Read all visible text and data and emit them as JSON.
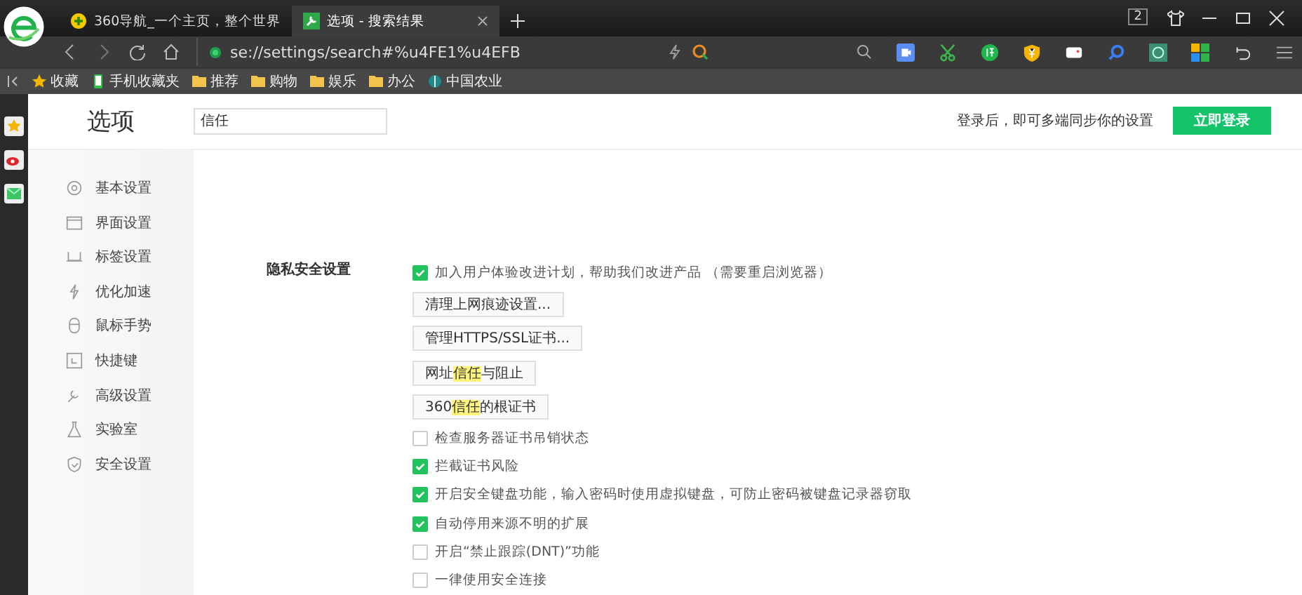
{
  "tabs": [
    {
      "title": "360导航_一个主页，整个世界",
      "selected": false
    },
    {
      "title": "选项 - 搜索结果",
      "selected": true
    }
  ],
  "window_controls": {
    "tab_count": "2"
  },
  "address_bar": {
    "url": "se://settings/search#%u4FE1%u4EFB"
  },
  "bookmarks": [
    {
      "label": "收藏",
      "kind": "star"
    },
    {
      "label": "手机收藏夹",
      "kind": "phone"
    },
    {
      "label": "推荐",
      "kind": "folder"
    },
    {
      "label": "购物",
      "kind": "folder"
    },
    {
      "label": "娱乐",
      "kind": "folder"
    },
    {
      "label": "办公",
      "kind": "folder"
    },
    {
      "label": "中国农业",
      "kind": "globe"
    }
  ],
  "settings": {
    "title": "选项",
    "search": {
      "value": "信任"
    },
    "login_hint": "登录后，即可多端同步你的设置",
    "login_button": "立即登录",
    "nav": [
      {
        "label": "基本设置"
      },
      {
        "label": "界面设置"
      },
      {
        "label": "标签设置"
      },
      {
        "label": "优化加速"
      },
      {
        "label": "鼠标手势"
      },
      {
        "label": "快捷键"
      },
      {
        "label": "高级设置"
      },
      {
        "label": "实验室"
      },
      {
        "label": "安全设置"
      }
    ],
    "section": {
      "title": "隐私安全设置",
      "items": [
        {
          "kind": "checkbox",
          "label": "加入用户体验改进计划，帮助我们改进产品 （需要重启浏览器）",
          "checked": true
        },
        {
          "kind": "button",
          "parts": [
            {
              "text": "清理上网痕迹设置...",
              "highlight": false
            }
          ]
        },
        {
          "kind": "button",
          "parts": [
            {
              "text": "管理HTTPS/SSL证书...",
              "highlight": false
            }
          ]
        },
        {
          "kind": "button",
          "parts": [
            {
              "text": "网址",
              "highlight": false
            },
            {
              "text": "信任",
              "highlight": true
            },
            {
              "text": "与阻止",
              "highlight": false
            }
          ]
        },
        {
          "kind": "button",
          "parts": [
            {
              "text": "360",
              "highlight": false
            },
            {
              "text": "信任",
              "highlight": true
            },
            {
              "text": "的根证书",
              "highlight": false
            }
          ]
        },
        {
          "kind": "checkbox",
          "label": "检查服务器证书吊销状态",
          "checked": false
        },
        {
          "kind": "checkbox",
          "label": "拦截证书风险",
          "checked": true
        },
        {
          "kind": "checkbox",
          "label": "开启安全键盘功能，输入密码时使用虚拟键盘，可防止密码被键盘记录器窃取",
          "checked": true
        },
        {
          "kind": "checkbox",
          "label": "自动停用来源不明的扩展",
          "checked": true
        },
        {
          "kind": "checkbox",
          "label": "开启“禁止跟踪(DNT)”功能",
          "checked": false
        },
        {
          "kind": "checkbox",
          "label": "一律使用安全连接",
          "checked": false
        }
      ]
    }
  }
}
